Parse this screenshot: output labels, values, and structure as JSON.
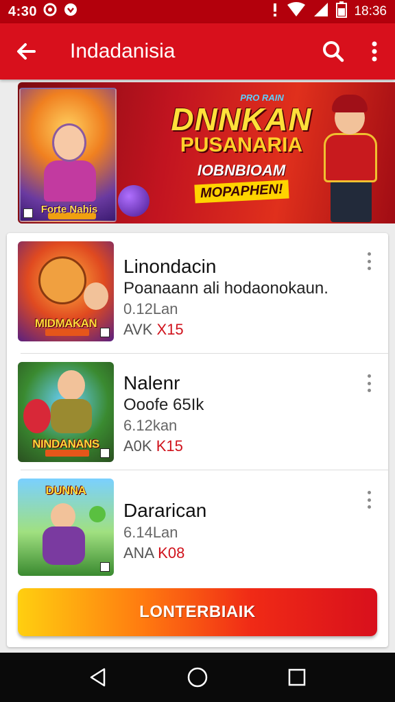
{
  "status_bar": {
    "time": "4:30",
    "notification_icons": [
      "settings-icon",
      "notification-icon"
    ],
    "battery_text": "18:36",
    "colors": {
      "background": "#b3000c"
    }
  },
  "app_bar": {
    "title": "Indadanisia",
    "back_icon": "arrow-back-icon",
    "search_icon": "search-icon",
    "menu_icon": "more-vert-icon",
    "colors": {
      "background": "#d8101c"
    }
  },
  "banner": {
    "thumb_label": "Forte Nahis",
    "tag": "PRO RAIN",
    "headline_1": "DNNKAN",
    "headline_2": "PUSANARIA",
    "subline_1": "IOBNBIOAM",
    "subline_2": "MOPAPHEN!"
  },
  "items": [
    {
      "title": "Linondacin",
      "description": "Poanaann ali hodaonokaun.",
      "size": "0.12Lan",
      "meta_prefix": "AVK",
      "meta_accent": "X15",
      "thumb_label": "MIDMAKAN"
    },
    {
      "title": "Nalenr",
      "description": "Ooofe 65Ik",
      "size": "6.12kan",
      "meta_prefix": "A0K",
      "meta_accent": "K15",
      "thumb_label": "NINDANANS"
    },
    {
      "title": "Dararican",
      "description": "",
      "size": "6.14Lan",
      "meta_prefix": "ANA",
      "meta_accent": "K08",
      "thumb_label": "DUNNA"
    }
  ],
  "cta": {
    "label": "LONTERBIAIK"
  },
  "nav_bar": {
    "icons": [
      "back-triangle-icon",
      "home-circle-icon",
      "recents-square-icon"
    ]
  },
  "colors": {
    "accent": "#d8101c",
    "cta_start": "#ffcf10",
    "cta_end": "#d8101c"
  }
}
